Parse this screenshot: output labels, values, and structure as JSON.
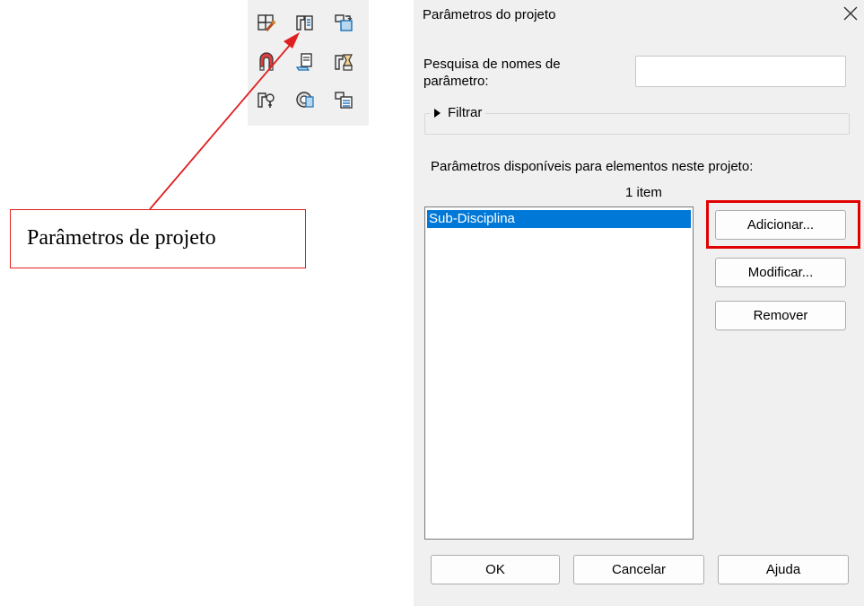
{
  "ribbon": {
    "icons": [
      "family-types-icon",
      "project-parameters-icon",
      "transfer-standards-icon",
      "purge-unused-icon",
      "project-units-icon",
      "shared-parameters-icon",
      "global-parameters-icon",
      "render-settings-icon",
      "structural-settings-icon"
    ]
  },
  "callout": {
    "text": "Parâmetros de projeto",
    "color": "#e02020"
  },
  "dialog": {
    "title": "Parâmetros do projeto",
    "close_icon": "close-icon",
    "search_label": "Pesquisa de nomes de parâmetro:",
    "search_value": "",
    "filter_label": "Filtrar",
    "available_label": "Parâmetros disponíveis para elementos neste projeto:",
    "count_label": "1 item",
    "items": [
      {
        "label": "Sub-Disciplina",
        "selected": true
      }
    ],
    "buttons": {
      "add": "Adicionar...",
      "modify": "Modificar...",
      "remove": "Remover",
      "ok": "OK",
      "cancel": "Cancelar",
      "help": "Ajuda"
    },
    "highlight_color": "#e00000",
    "selection_color": "#0078d7"
  }
}
